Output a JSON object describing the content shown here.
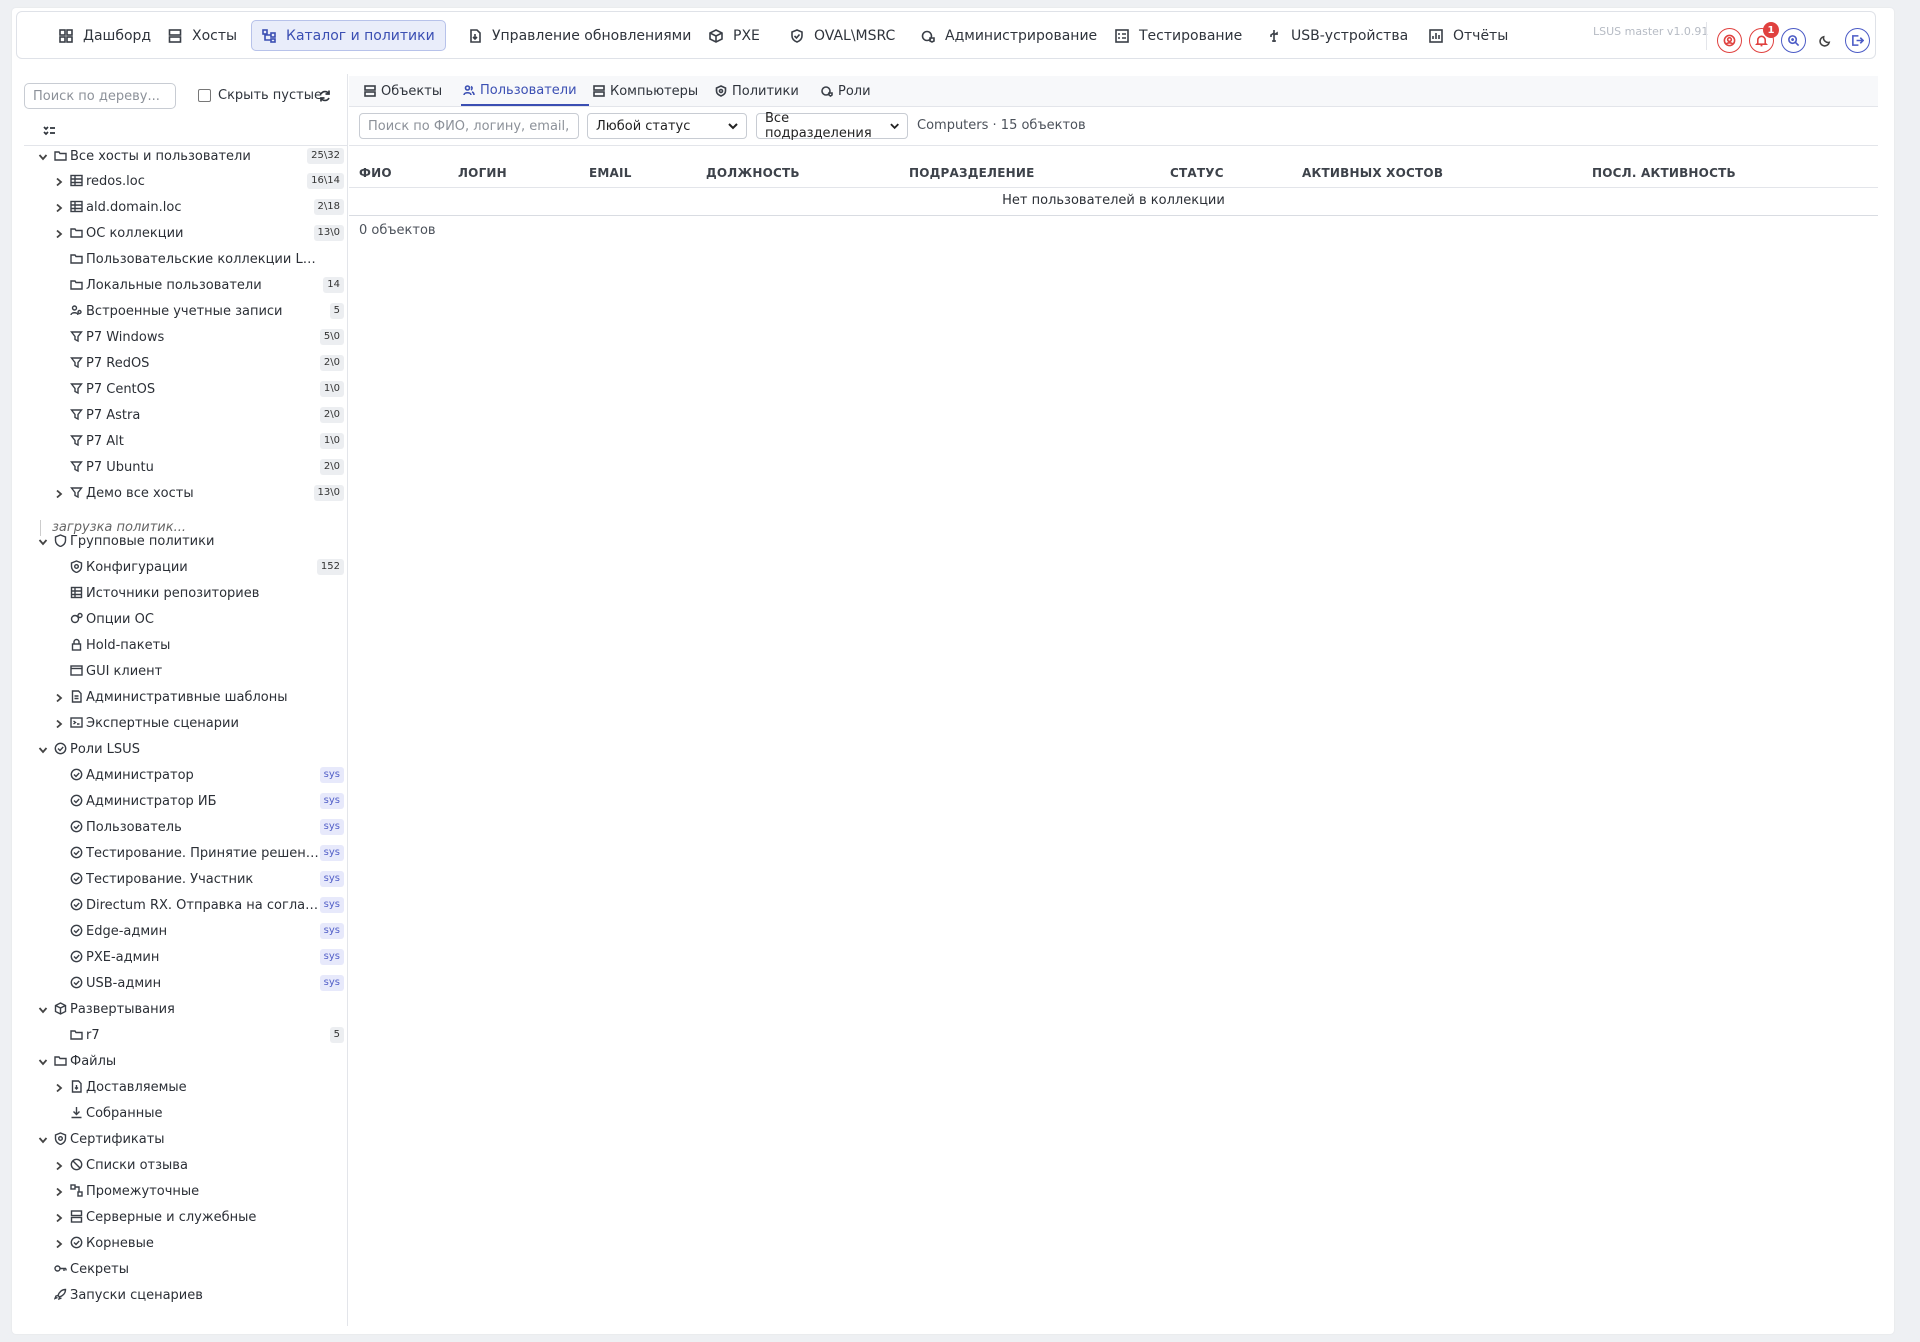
{
  "topnav": {
    "items": [
      {
        "label": "Дашборд",
        "icon": "dashboard-icon"
      },
      {
        "label": "Хосты",
        "icon": "server-icon"
      },
      {
        "label": "Каталог и политики",
        "icon": "hierarchy-icon",
        "active": true
      },
      {
        "label": "Управление обновлениями",
        "icon": "file-update-icon"
      },
      {
        "label": "PXE",
        "icon": "box-icon"
      },
      {
        "label": "OVAL\\MSRC",
        "icon": "shield-check-icon"
      },
      {
        "label": "Администрирование",
        "icon": "gear-shield-icon"
      },
      {
        "label": "Тестирование",
        "icon": "checklist-icon"
      },
      {
        "label": "USB-устройства",
        "icon": "usb-icon"
      },
      {
        "label": "Отчёты",
        "icon": "chart-icon"
      }
    ],
    "version": "LSUS master v1.0.91",
    "notification_count": "1"
  },
  "sidebar": {
    "search_placeholder": "Поиск по дереву...",
    "hide_empty_label": "Скрыть пустые",
    "loading_text": "загрузка политик...",
    "tree": [
      {
        "label": "Все хосты и пользователи",
        "count": "25\\32"
      },
      {
        "label": "redos.loc",
        "count": "16\\14"
      },
      {
        "label": "ald.domain.loc",
        "count": "2\\18"
      },
      {
        "label": "ОС коллекции",
        "count": "13\\0"
      },
      {
        "label": "Пользовательские коллекции LSUS"
      },
      {
        "label": "Локальные пользователи",
        "count": "14"
      },
      {
        "label": "Встроенные учетные записи",
        "count": "5"
      },
      {
        "label": "Р7 Windows",
        "count": "5\\0"
      },
      {
        "label": "Р7 RedOS",
        "count": "2\\0"
      },
      {
        "label": "Р7 CentOS",
        "count": "1\\0"
      },
      {
        "label": "Р7 Astra",
        "count": "2\\0"
      },
      {
        "label": "Р7 Alt",
        "count": "1\\0"
      },
      {
        "label": "Р7 Ubuntu",
        "count": "2\\0"
      },
      {
        "label": "Демо все хосты",
        "count": "13\\0"
      },
      {
        "label": "Групповые политики"
      },
      {
        "label": "Конфигурации",
        "count": "152"
      },
      {
        "label": "Источники репозиториев"
      },
      {
        "label": "Опции ОС"
      },
      {
        "label": "Hold-пакеты"
      },
      {
        "label": "GUI клиент"
      },
      {
        "label": "Административные шаблоны"
      },
      {
        "label": "Экспертные сценарии"
      },
      {
        "label": "Роли LSUS"
      },
      {
        "label": "Администратор",
        "sys": "sys"
      },
      {
        "label": "Администратор ИБ",
        "sys": "sys"
      },
      {
        "label": "Пользователь",
        "sys": "sys"
      },
      {
        "label": "Тестирование. Принятие решений",
        "sys": "sys"
      },
      {
        "label": "Тестирование. Участник",
        "sys": "sys"
      },
      {
        "label": "Directum RX. Отправка на согласование",
        "sys": "sys"
      },
      {
        "label": "Edge-админ",
        "sys": "sys"
      },
      {
        "label": "PXE-админ",
        "sys": "sys"
      },
      {
        "label": "USB-админ",
        "sys": "sys"
      },
      {
        "label": "Развертывания"
      },
      {
        "label": "r7",
        "count": "5"
      },
      {
        "label": "Файлы"
      },
      {
        "label": "Доставляемые"
      },
      {
        "label": "Собранные"
      },
      {
        "label": "Сертификаты"
      },
      {
        "label": "Списки отзыва"
      },
      {
        "label": "Промежуточные"
      },
      {
        "label": "Серверные и служебные"
      },
      {
        "label": "Корневые"
      },
      {
        "label": "Секреты"
      },
      {
        "label": "Запуски сценариев"
      }
    ]
  },
  "main": {
    "tabs": [
      {
        "label": "Объекты"
      },
      {
        "label": "Пользователи",
        "active": true
      },
      {
        "label": "Компьютеры"
      },
      {
        "label": "Политики"
      },
      {
        "label": "Роли"
      }
    ],
    "search_placeholder": "Поиск по ФИО, логину, email, должности",
    "status_filter": "Любой статус",
    "department_filter": "Все подразделения",
    "summary": "Computers · 15 объектов",
    "columns": [
      "ФИО",
      "ЛОГИН",
      "EMAIL",
      "ДОЛЖНОСТЬ",
      "ПОДРАЗДЕЛЕНИЕ",
      "СТАТУС",
      "АКТИВНЫХ ХОСТОВ",
      "ПОСЛ. АКТИВНОСТЬ"
    ],
    "empty_text": "Нет пользователей в коллекции",
    "object_count": "0 объектов"
  },
  "colors": {
    "accent": "#3b4fb3",
    "danger": "#e0413f",
    "sys_badge": "#5360c8"
  }
}
